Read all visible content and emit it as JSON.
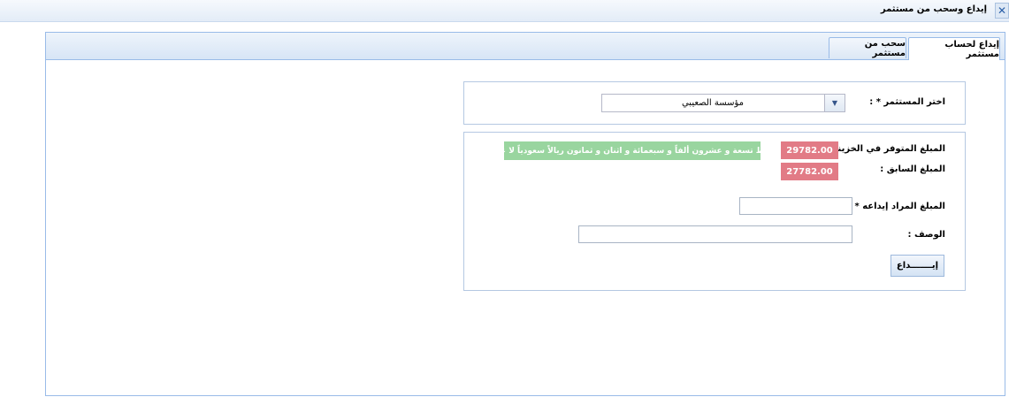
{
  "window": {
    "title": "إيداع وسحب من مستثمر",
    "close_icon": "close-icon"
  },
  "tabs": [
    {
      "label": "إيداع لحساب مستثمر",
      "active": true
    },
    {
      "label": "سحب من مستثمر",
      "active": false
    }
  ],
  "investor": {
    "label": "اختر المستثمر * :",
    "selected": "مؤسسة الصعيبي",
    "dropdown_icon": "chevron-down-icon"
  },
  "balance": {
    "available_label": "المبلغ المتوفر في الخزينة :",
    "available_value": "29782.00",
    "available_words": "فقط تسعة و عشرون ألفاً و سبعمائة و اثنان و ثمانون ريالاً سعودياً لا غير.",
    "previous_label": "المبلغ السابق :",
    "previous_value": "27782.00"
  },
  "form": {
    "amount_label": "المبلغ المراد إيداعه * :",
    "amount_value": "",
    "description_label": "الوصف :",
    "description_value": "",
    "submit_label": "إيـــــــداع"
  },
  "colors": {
    "amount_badge": "#e27b86",
    "words_badge": "#99d59f",
    "accent_border": "#99bbe8"
  }
}
